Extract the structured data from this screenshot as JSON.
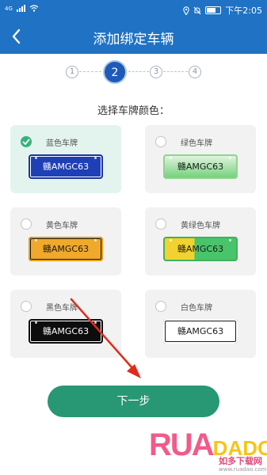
{
  "status_bar": {
    "network": "4G",
    "signal_icon": "signal-icon",
    "wifi_icon": "wifi-icon",
    "icons": [
      "location-icon",
      "mute-icon",
      "battery-icon"
    ],
    "time": "下午2:05"
  },
  "header": {
    "title": "添加绑定车辆",
    "back_icon": "chevron-left-icon",
    "background_color": "#1f72c4"
  },
  "steps": {
    "items": [
      "1",
      "2",
      "3",
      "4"
    ],
    "current": "2",
    "active_color": "#1e5bb8"
  },
  "prompt": "选择车牌颜色：",
  "plate_options": [
    {
      "label": "蓝色车牌",
      "plate_text": "赣AMGC63",
      "color": "blue",
      "selected": true
    },
    {
      "label": "绿色车牌",
      "plate_text": "赣AMGC63",
      "color": "green",
      "selected": false
    },
    {
      "label": "黄色车牌",
      "plate_text": "赣AMGC63",
      "color": "yellow",
      "selected": false
    },
    {
      "label": "黄绿色车牌",
      "plate_text": "赣AMGC63",
      "color": "yellow-green",
      "selected": false
    },
    {
      "label": "黑色车牌",
      "plate_text": "赣AMGC63",
      "color": "black",
      "selected": false
    },
    {
      "label": "白色车牌",
      "plate_text": "赣AMGC63",
      "color": "white",
      "selected": false
    }
  ],
  "next_button": {
    "label": "下一步",
    "color": "#279873"
  },
  "annotation": {
    "icon": "red-arrow-icon",
    "color": "#e02b1e"
  },
  "watermark": {
    "logo": "RUADADO",
    "text": "如多下载网",
    "url": "www.ruadao.com"
  }
}
